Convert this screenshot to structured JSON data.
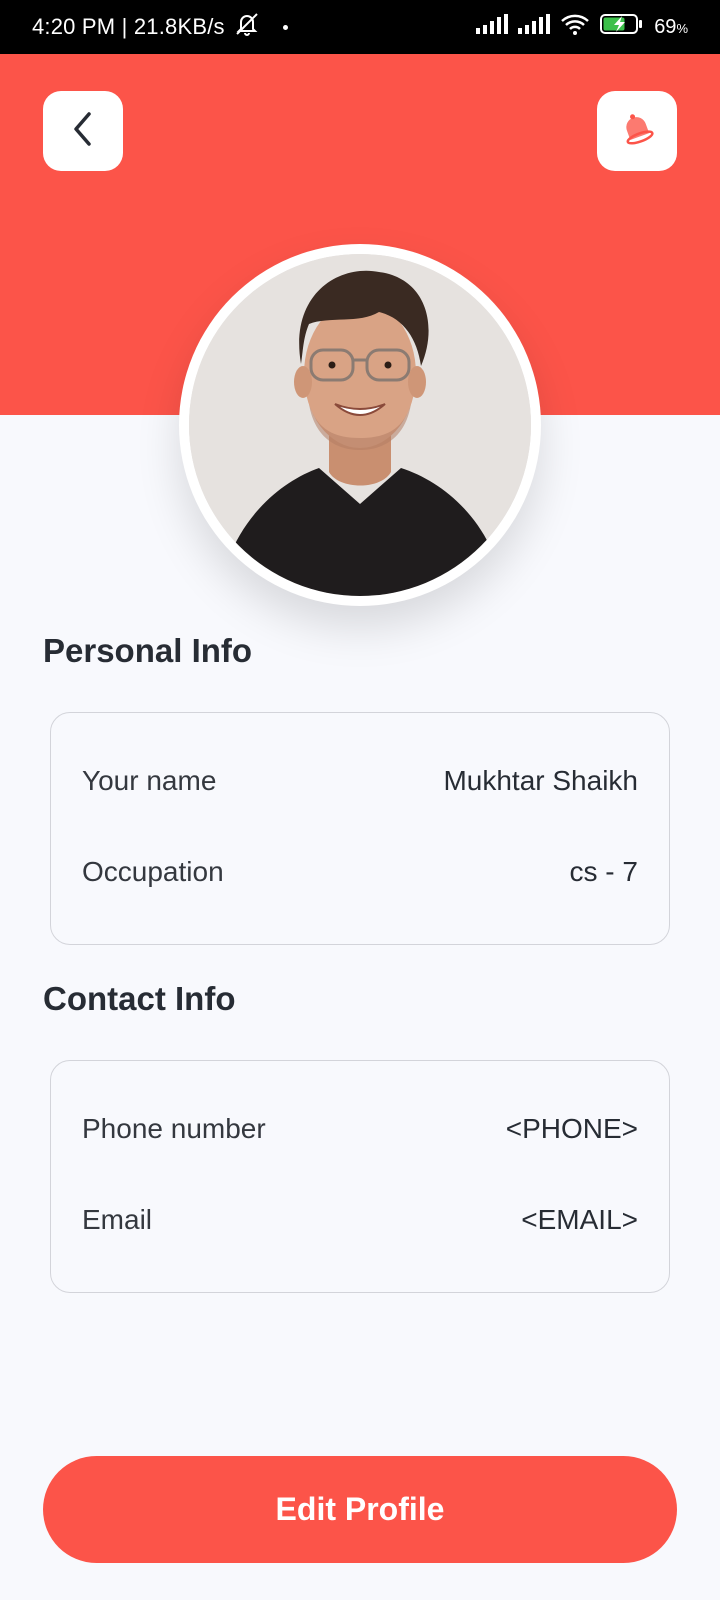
{
  "status_bar": {
    "time_speed": "4:20 PM | 21.8KB/s",
    "battery_pct": "69",
    "battery_unit": "%"
  },
  "header": {
    "color": "#fc5449",
    "back_icon": "chevron-left-icon",
    "bell_icon": "bell-icon"
  },
  "personal_info": {
    "title": "Personal Info",
    "rows": [
      {
        "label": "Your name",
        "value": "Mukhtar Shaikh"
      },
      {
        "label": "Occupation",
        "value": "cs - 7"
      }
    ]
  },
  "contact_info": {
    "title": "Contact Info",
    "rows": [
      {
        "label": "Phone number",
        "value": "<PHONE>"
      },
      {
        "label": "Email",
        "value": "<EMAIL>"
      }
    ]
  },
  "actions": {
    "edit_profile": "Edit Profile"
  }
}
